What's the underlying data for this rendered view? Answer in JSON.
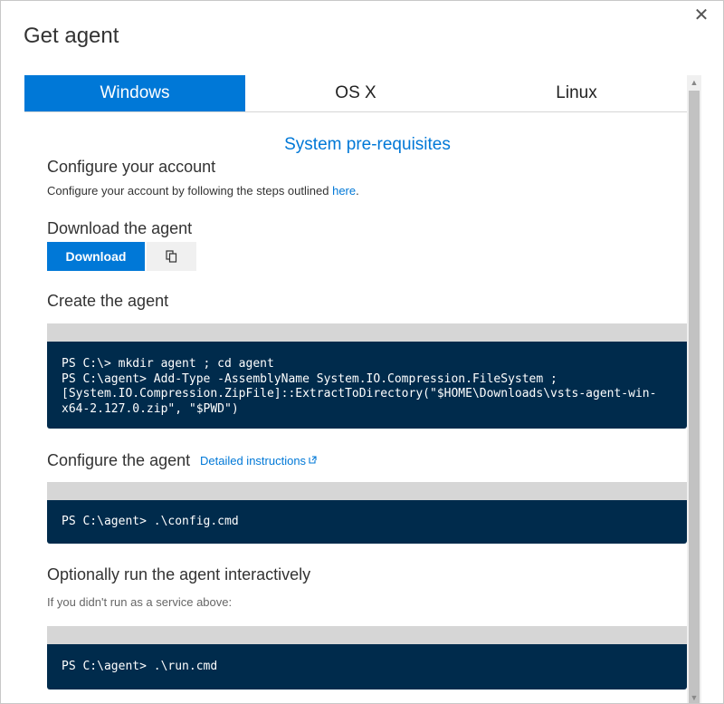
{
  "dialog": {
    "title": "Get agent",
    "close_glyph": "✕"
  },
  "tabs": [
    {
      "label": "Windows",
      "active": true
    },
    {
      "label": "OS X",
      "active": false
    },
    {
      "label": "Linux",
      "active": false
    }
  ],
  "content": {
    "prereq_link": "System pre-requisites",
    "configure_account": {
      "heading": "Configure your account",
      "text": "Configure your account by following the steps outlined ",
      "link": "here",
      "suffix": "."
    },
    "download": {
      "heading": "Download the agent",
      "button_label": "Download",
      "copy_icon": "copy-icon"
    },
    "create": {
      "heading": "Create the agent",
      "code_lines": [
        "PS C:\\> mkdir agent ; cd agent",
        "PS C:\\agent> Add-Type -AssemblyName System.IO.Compression.FileSystem ;",
        "[System.IO.Compression.ZipFile]::ExtractToDirectory(\"$HOME\\Downloads\\vsts-agent-win-",
        "x64-2.127.0.zip\", \"$PWD\")"
      ]
    },
    "configure_agent": {
      "heading": "Configure the agent",
      "link": "Detailed instructions",
      "code": "PS C:\\agent> .\\config.cmd"
    },
    "run": {
      "heading": "Optionally run the agent interactively",
      "note": "If you didn't run as a service above:",
      "code": "PS C:\\agent> .\\run.cmd"
    }
  },
  "colors": {
    "accent": "#0078d7",
    "code_bg": "#002b4c",
    "code_header": "#d6d6d6"
  }
}
